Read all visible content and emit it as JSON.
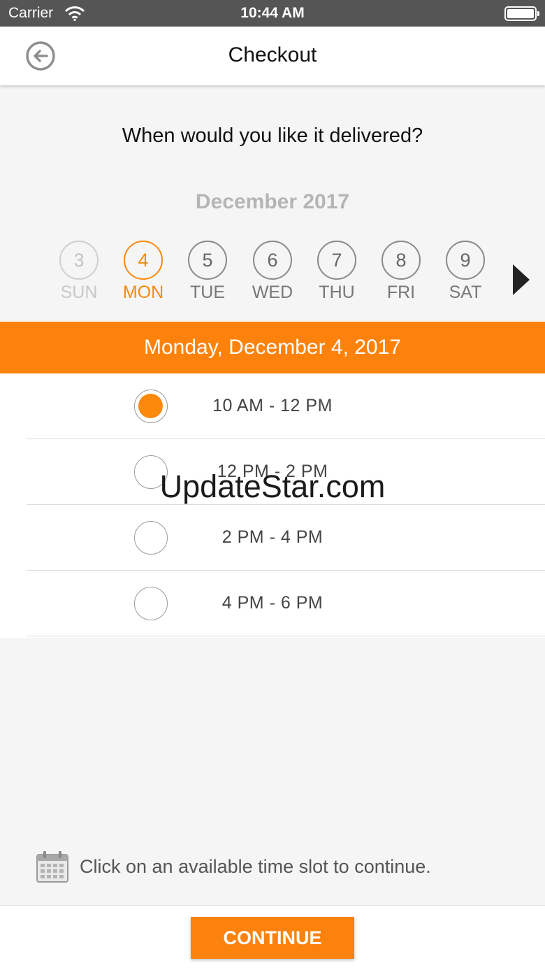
{
  "status_bar": {
    "carrier": "Carrier",
    "time": "10:44 AM",
    "icons": [
      "wifi-icon",
      "battery-icon"
    ]
  },
  "nav": {
    "title": "Checkout",
    "back_icon": "arrow-left-circle-icon"
  },
  "question": "When would you like it delivered?",
  "calendar": {
    "month_label": "December 2017",
    "days": [
      {
        "num": "3",
        "weekday": "SUN",
        "state": "disabled"
      },
      {
        "num": "4",
        "weekday": "MON",
        "state": "selected"
      },
      {
        "num": "5",
        "weekday": "TUE",
        "state": "available"
      },
      {
        "num": "6",
        "weekday": "WED",
        "state": "available"
      },
      {
        "num": "7",
        "weekday": "THU",
        "state": "available"
      },
      {
        "num": "8",
        "weekday": "FRI",
        "state": "available"
      },
      {
        "num": "9",
        "weekday": "SAT",
        "state": "available"
      }
    ],
    "next_icon": "triangle-right-icon"
  },
  "selected_date": "Monday, December 4, 2017",
  "time_slots": [
    {
      "label": "10 AM - 12 PM",
      "selected": true
    },
    {
      "label": "12 PM - 2 PM",
      "selected": false
    },
    {
      "label": "2 PM - 4 PM",
      "selected": false
    },
    {
      "label": "4 PM - 6 PM",
      "selected": false
    }
  ],
  "watermark": "UpdateStar.com",
  "hint": {
    "icon": "calendar-icon",
    "text": "Click on an available time slot to continue."
  },
  "footer": {
    "continue_label": "CONTINUE"
  },
  "colors": {
    "accent": "#fc820b",
    "status_bar": "#555555",
    "background": "#f5f5f5"
  }
}
